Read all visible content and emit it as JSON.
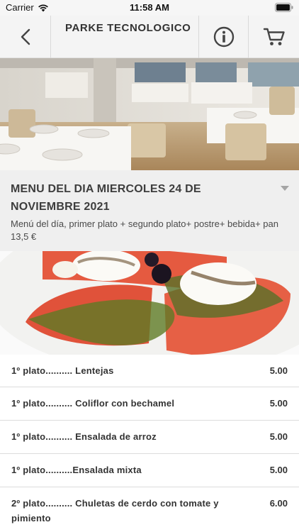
{
  "status_bar": {
    "carrier": "Carrier",
    "time": "11:58 AM"
  },
  "header": {
    "title": "PARKE TECNOLOGICO"
  },
  "menu": {
    "title": "MENU DEL DIA MIERCOLES 24 DE NOVIEMBRE 2021",
    "description": "Menú del día, primer plato + segundo plato+ postre+ bebida+ pan 13,5 €"
  },
  "items": [
    {
      "name": "1º plato.......... Lentejas",
      "price": "5.00"
    },
    {
      "name": "1º plato.......... Coliflor con bechamel",
      "price": "5.00"
    },
    {
      "name": "1º plato.......... Ensalada de arroz",
      "price": "5.00"
    },
    {
      "name": "1º plato..........Ensalada mixta",
      "price": "5.00"
    },
    {
      "name": "2º plato.......... Chuletas de cerdo con tomate y pimiento",
      "price": "6.00"
    }
  ],
  "colors": {
    "accent": "#333333",
    "header_bg": "#f4f4f4",
    "intro_bg": "#efefef"
  }
}
